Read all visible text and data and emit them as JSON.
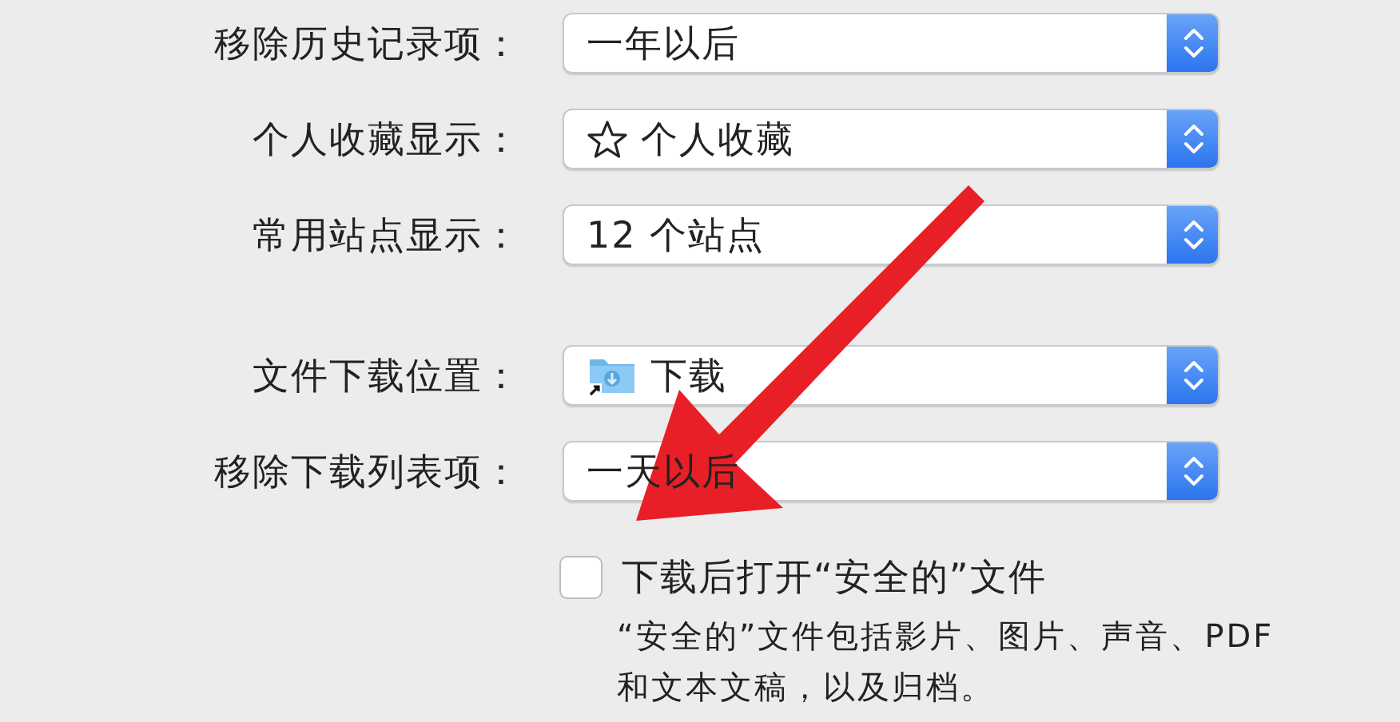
{
  "groups": [
    [
      {
        "label": "移除历史记录项：",
        "value": "一年以后"
      },
      {
        "label": "个人收藏显示：",
        "value": "个人收藏",
        "kind": "star"
      },
      {
        "label": "常用站点显示：",
        "value": "12 个站点"
      }
    ],
    [
      {
        "label": "文件下载位置：",
        "value": "下载",
        "kind": "folder"
      },
      {
        "label": "移除下载列表项：",
        "value": "一天以后"
      }
    ]
  ],
  "safe_files": {
    "label": "下载后打开“安全的”文件",
    "checked": false,
    "note": "“安全的”文件包括影片、图片、声音、PDF和文本文稿，以及归档。"
  }
}
